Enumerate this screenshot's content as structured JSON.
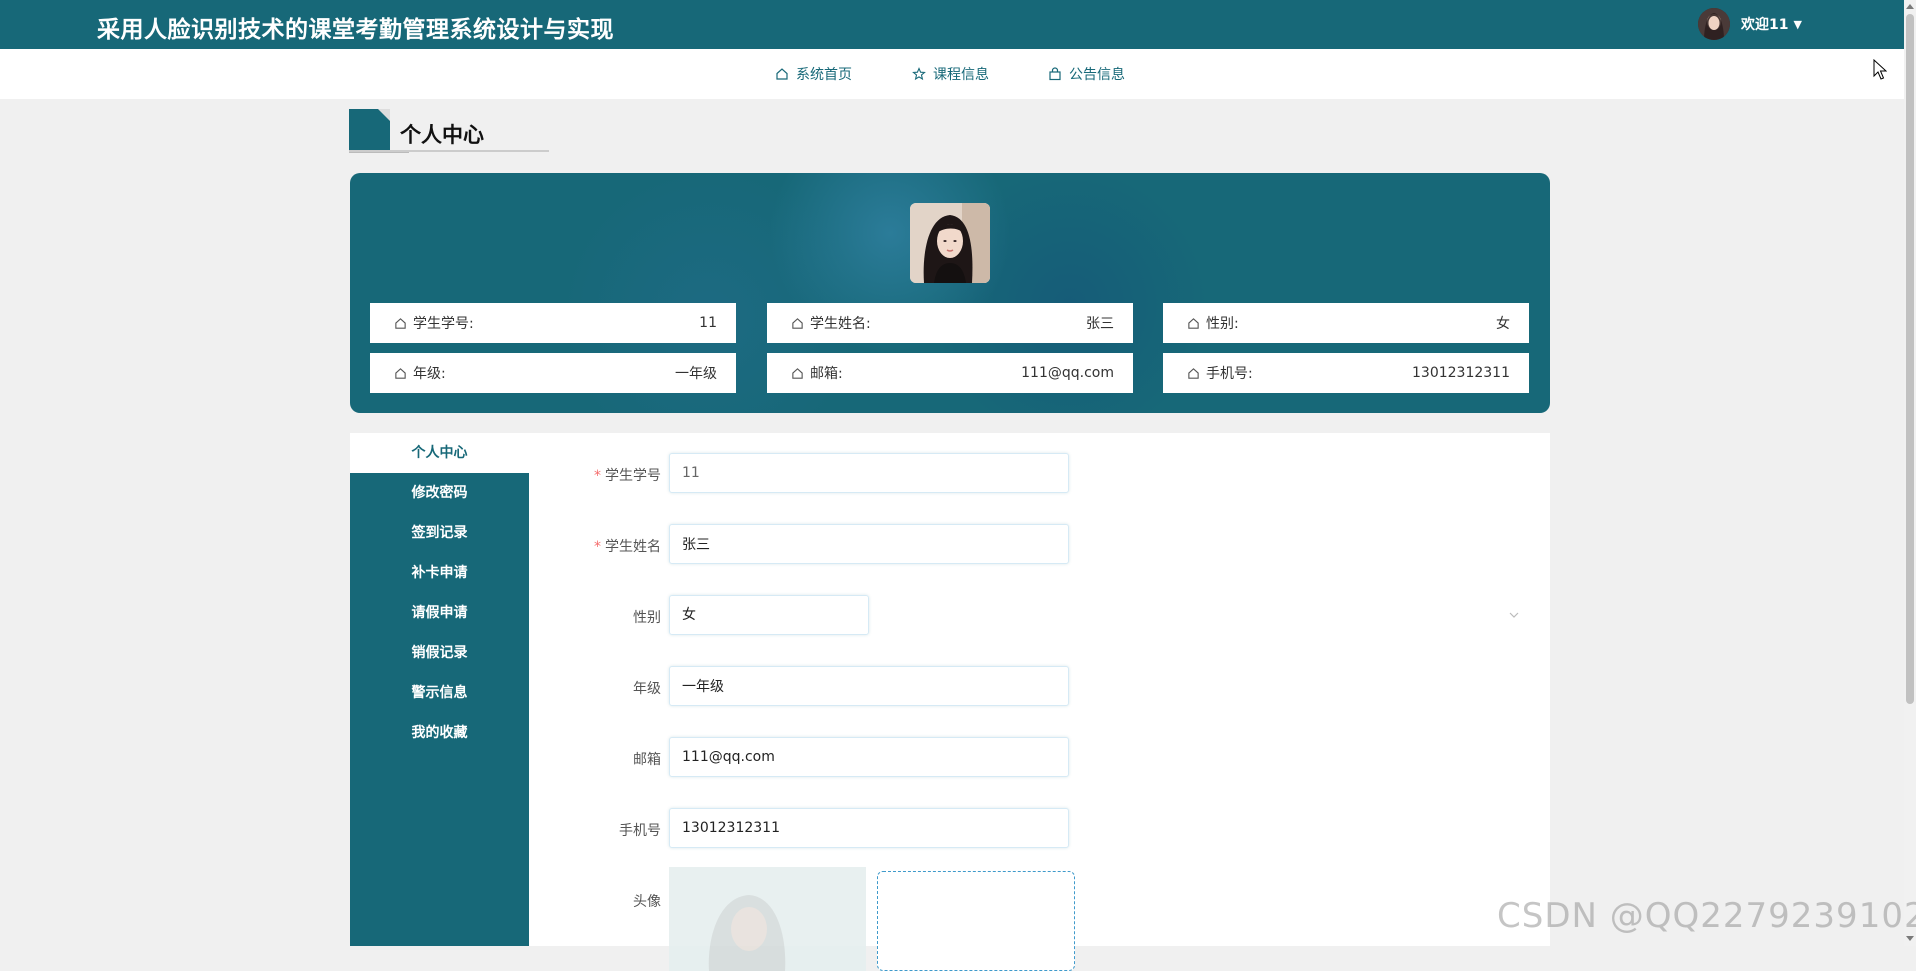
{
  "header": {
    "title": "采用人脸识别技术的课堂考勤管理系统设计与实现",
    "welcome": "欢迎11",
    "user_menu_icon": "caret-down-icon"
  },
  "nav": {
    "items": [
      {
        "label": "系统首页",
        "icon": "home-icon"
      },
      {
        "label": "课程信息",
        "icon": "star-icon"
      },
      {
        "label": "公告信息",
        "icon": "bag-icon"
      }
    ]
  },
  "section": {
    "title": "个人中心"
  },
  "profile": {
    "cards": [
      {
        "label": "学生学号:",
        "value": "11"
      },
      {
        "label": "学生姓名:",
        "value": "张三"
      },
      {
        "label": "性别:",
        "value": "女"
      },
      {
        "label": "年级:",
        "value": "一年级"
      },
      {
        "label": "邮箱:",
        "value": "111@qq.com"
      },
      {
        "label": "手机号:",
        "value": "13012312311"
      }
    ]
  },
  "sidebar": {
    "items": [
      {
        "label": "个人中心",
        "active": true
      },
      {
        "label": "修改密码"
      },
      {
        "label": "签到记录"
      },
      {
        "label": "补卡申请"
      },
      {
        "label": "请假申请"
      },
      {
        "label": "销假记录"
      },
      {
        "label": "警示信息"
      },
      {
        "label": "我的收藏"
      }
    ]
  },
  "form": {
    "student_id": {
      "label": "学生学号",
      "value": "11",
      "required": true
    },
    "student_name": {
      "label": "学生姓名",
      "value": "张三",
      "required": true
    },
    "gender": {
      "label": "性别",
      "value": "女"
    },
    "grade": {
      "label": "年级",
      "value": "一年级"
    },
    "email": {
      "label": "邮箱",
      "value": "111@qq.com"
    },
    "phone": {
      "label": "手机号",
      "value": "13012312311"
    },
    "avatar": {
      "label": "头像"
    }
  },
  "watermark": "CSDN @QQ2279239102",
  "colors": {
    "primary": "#176878",
    "background": "#f0f0f0",
    "required": "#f56c6c"
  }
}
